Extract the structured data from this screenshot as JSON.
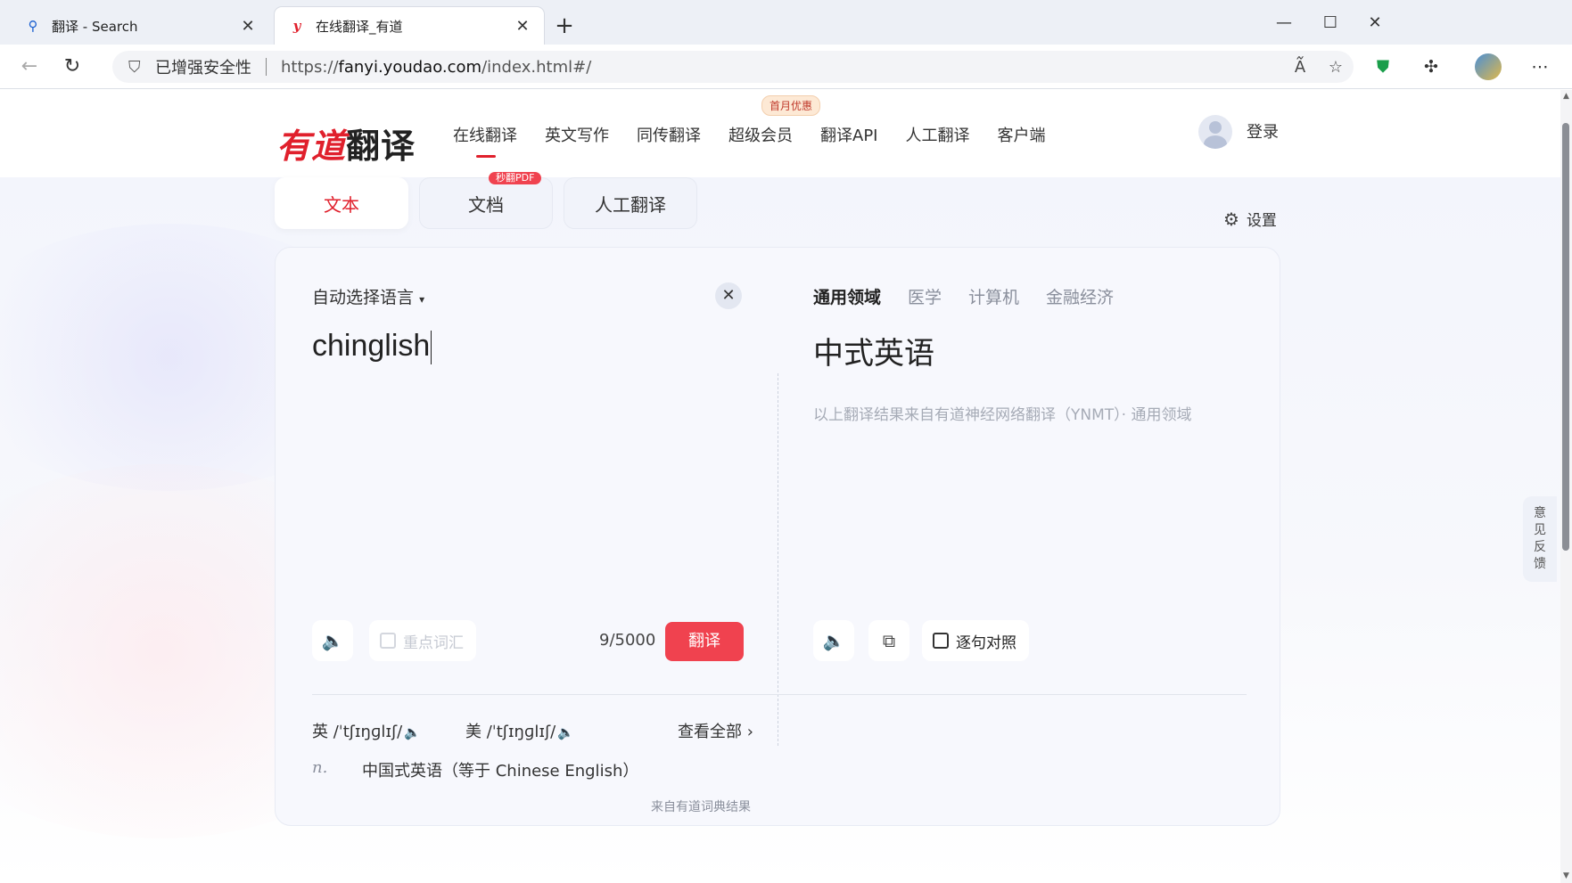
{
  "browser": {
    "tabs": [
      {
        "title": "翻译 - Search",
        "favicon": "search-icon"
      },
      {
        "title": "在线翻译_有道",
        "favicon": "youdao-y-icon"
      }
    ],
    "security_label": "已增强安全性",
    "url_prefix": "https://",
    "url_host": "fanyi.youdao.com",
    "url_path": "/index.html#/"
  },
  "header": {
    "logo_part1": "有道",
    "logo_part2": "翻译",
    "nav": [
      "在线翻译",
      "英文写作",
      "同传翻译",
      "超级会员",
      "翻译API",
      "人工翻译",
      "客户端"
    ],
    "promo_badge": "首月优惠",
    "login": "登录"
  },
  "mode_tabs": {
    "text": "文本",
    "doc": "文档",
    "doc_badge": "秒翻PDF",
    "human": "人工翻译"
  },
  "settings_label": "设置",
  "source": {
    "language": "自动选择语言",
    "text": "chinglish",
    "keyword_checkbox": "重点词汇",
    "counter": "9/5000",
    "translate_button": "翻译"
  },
  "target": {
    "domains": [
      "通用领域",
      "医学",
      "计算机",
      "金融经济"
    ],
    "text": "中式英语",
    "note": "以上翻译结果来自有道神经网络翻译（YNMT）· 通用领域",
    "sentence_checkbox": "逐句对照"
  },
  "dictionary": {
    "uk_label": "英",
    "uk_phonetic": "/ˈtʃɪŋɡlɪʃ/",
    "us_label": "美",
    "us_phonetic": "/ˈtʃɪŋɡlɪʃ/",
    "see_all": "查看全部",
    "pos": "n.",
    "definition": "中国式英语（等于 Chinese English）",
    "source_note": "来自有道词典结果"
  },
  "feedback": "意见反馈",
  "colors": {
    "brand_red": "#e0202c",
    "button_red": "#f0424f"
  }
}
